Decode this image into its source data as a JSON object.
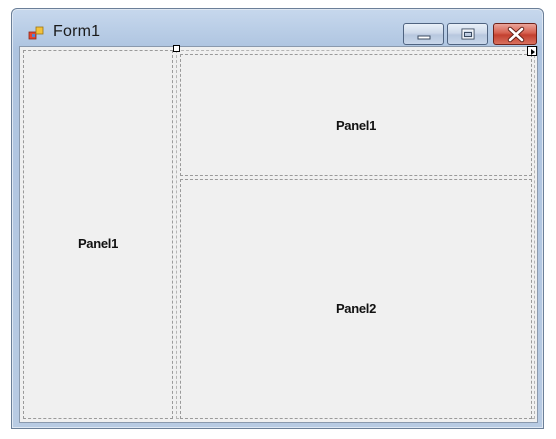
{
  "window": {
    "title": "Form1",
    "icon": "form-app-icon",
    "controls": {
      "minimize_icon": "minimize-icon",
      "maximize_icon": "maximize-icon",
      "close_icon": "close-icon"
    }
  },
  "designer": {
    "left_panel": {
      "label": "Panel1"
    },
    "right_split": {
      "top_panel": {
        "label": "Panel1"
      },
      "bottom_panel": {
        "label": "Panel2"
      }
    },
    "selection_handle_icon": "resize-handle-icon",
    "smart_tag_icon": "smart-tag-arrow-icon"
  },
  "colors": {
    "title_bar": "#b9cde6",
    "client_background": "#f0f0f0",
    "close_button": "#c3402f",
    "panel_border": "#9a9a9a"
  }
}
